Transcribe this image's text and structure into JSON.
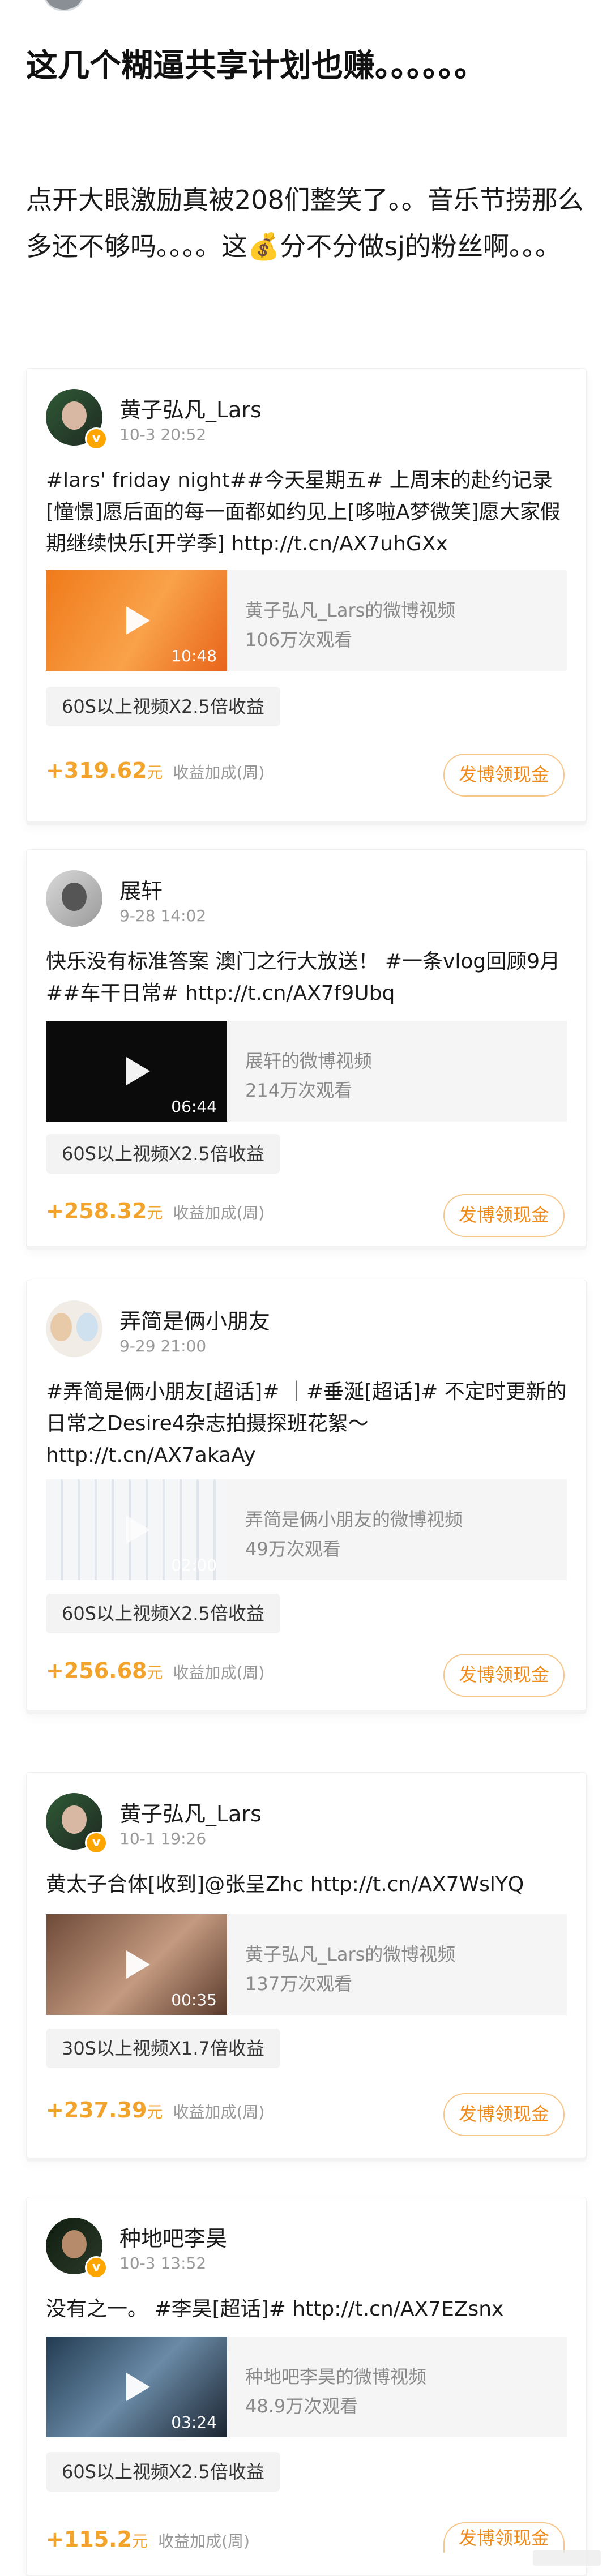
{
  "post": {
    "title": "这几个糊逼共享计划也赚。。。。。。",
    "body_before_emoji": "点开大眼激励真被208们整笑了。。音乐节捞那么多还不够吗。。。。这",
    "emoji": "💰",
    "body_after_emoji": "分不分做sj的粉丝啊。。。"
  },
  "cards": [
    {
      "name": "黄子弘凡_Lars",
      "time": "10-3 20:52",
      "text": "#lars' friday night##今天星期五# 上周末的赴约记录[憧憬]愿后面的每一面都如约见上[哆啦A梦微笑]愿大家假期继续快乐[开学季] http://t.cn/AX7uhGXx",
      "video_title": "黄子弘凡_Lars的微博视频",
      "video_views": "106万次观看",
      "duration": "10:48",
      "tag": "60S以上视频X2.5倍收益",
      "amount": "+319.62",
      "unit": "元",
      "note": "收益加成(周)",
      "button": "发博领现金"
    },
    {
      "name": "展轩",
      "time": "9-28 14:02",
      "text": "快乐没有标准答案 澳门之行大放送！ #一条vlog回顾9月##车干日常# http://t.cn/AX7f9Ubq",
      "video_title": "展轩的微博视频",
      "video_views": "214万次观看",
      "duration": "06:44",
      "tag": "60S以上视频X2.5倍收益",
      "amount": "+258.32",
      "unit": "元",
      "note": "收益加成(周)",
      "button": "发博领现金"
    },
    {
      "name": "弄简是俩小朋友",
      "time": "9-29 21:00",
      "text": "#弄简是俩小朋友[超话]# ｜#垂涎[超话]# 不定时更新的日常之Desire4杂志拍摄探班花絮～ http://t.cn/AX7akaAy",
      "video_title": "弄简是俩小朋友的微博视频",
      "video_views": "49万次观看",
      "duration": "02:00",
      "tag": "60S以上视频X2.5倍收益",
      "amount": "+256.68",
      "unit": "元",
      "note": "收益加成(周)",
      "button": "发博领现金"
    },
    {
      "name": "黄子弘凡_Lars",
      "time": "10-1 19:26",
      "text": "黄太子合体[收到]@张呈Zhc http://t.cn/AX7WslYQ",
      "video_title": "黄子弘凡_Lars的微博视频",
      "video_views": "137万次观看",
      "duration": "00:35",
      "tag": "30S以上视频X1.7倍收益",
      "amount": "+237.39",
      "unit": "元",
      "note": "收益加成(周)",
      "button": "发博领现金"
    },
    {
      "name": "种地吧李昊",
      "time": "10-3 13:52",
      "text": "没有之一。 #李昊[超话]# http://t.cn/AX7EZsnx",
      "video_title": "种地吧李昊的微博视频",
      "video_views": "48.9万次观看",
      "duration": "03:24",
      "tag": "60S以上视频X2.5倍收益",
      "amount": "+115.2",
      "unit": "元",
      "note": "收益加成(周)",
      "button": "发博领现金"
    }
  ],
  "colors": {
    "amount": "#f2a32c",
    "button_text": "#f08c1c",
    "button_border": "#f6c68a",
    "verified_badge": "#ffa500"
  },
  "icons": [
    "play-icon",
    "verified-badge-icon"
  ]
}
